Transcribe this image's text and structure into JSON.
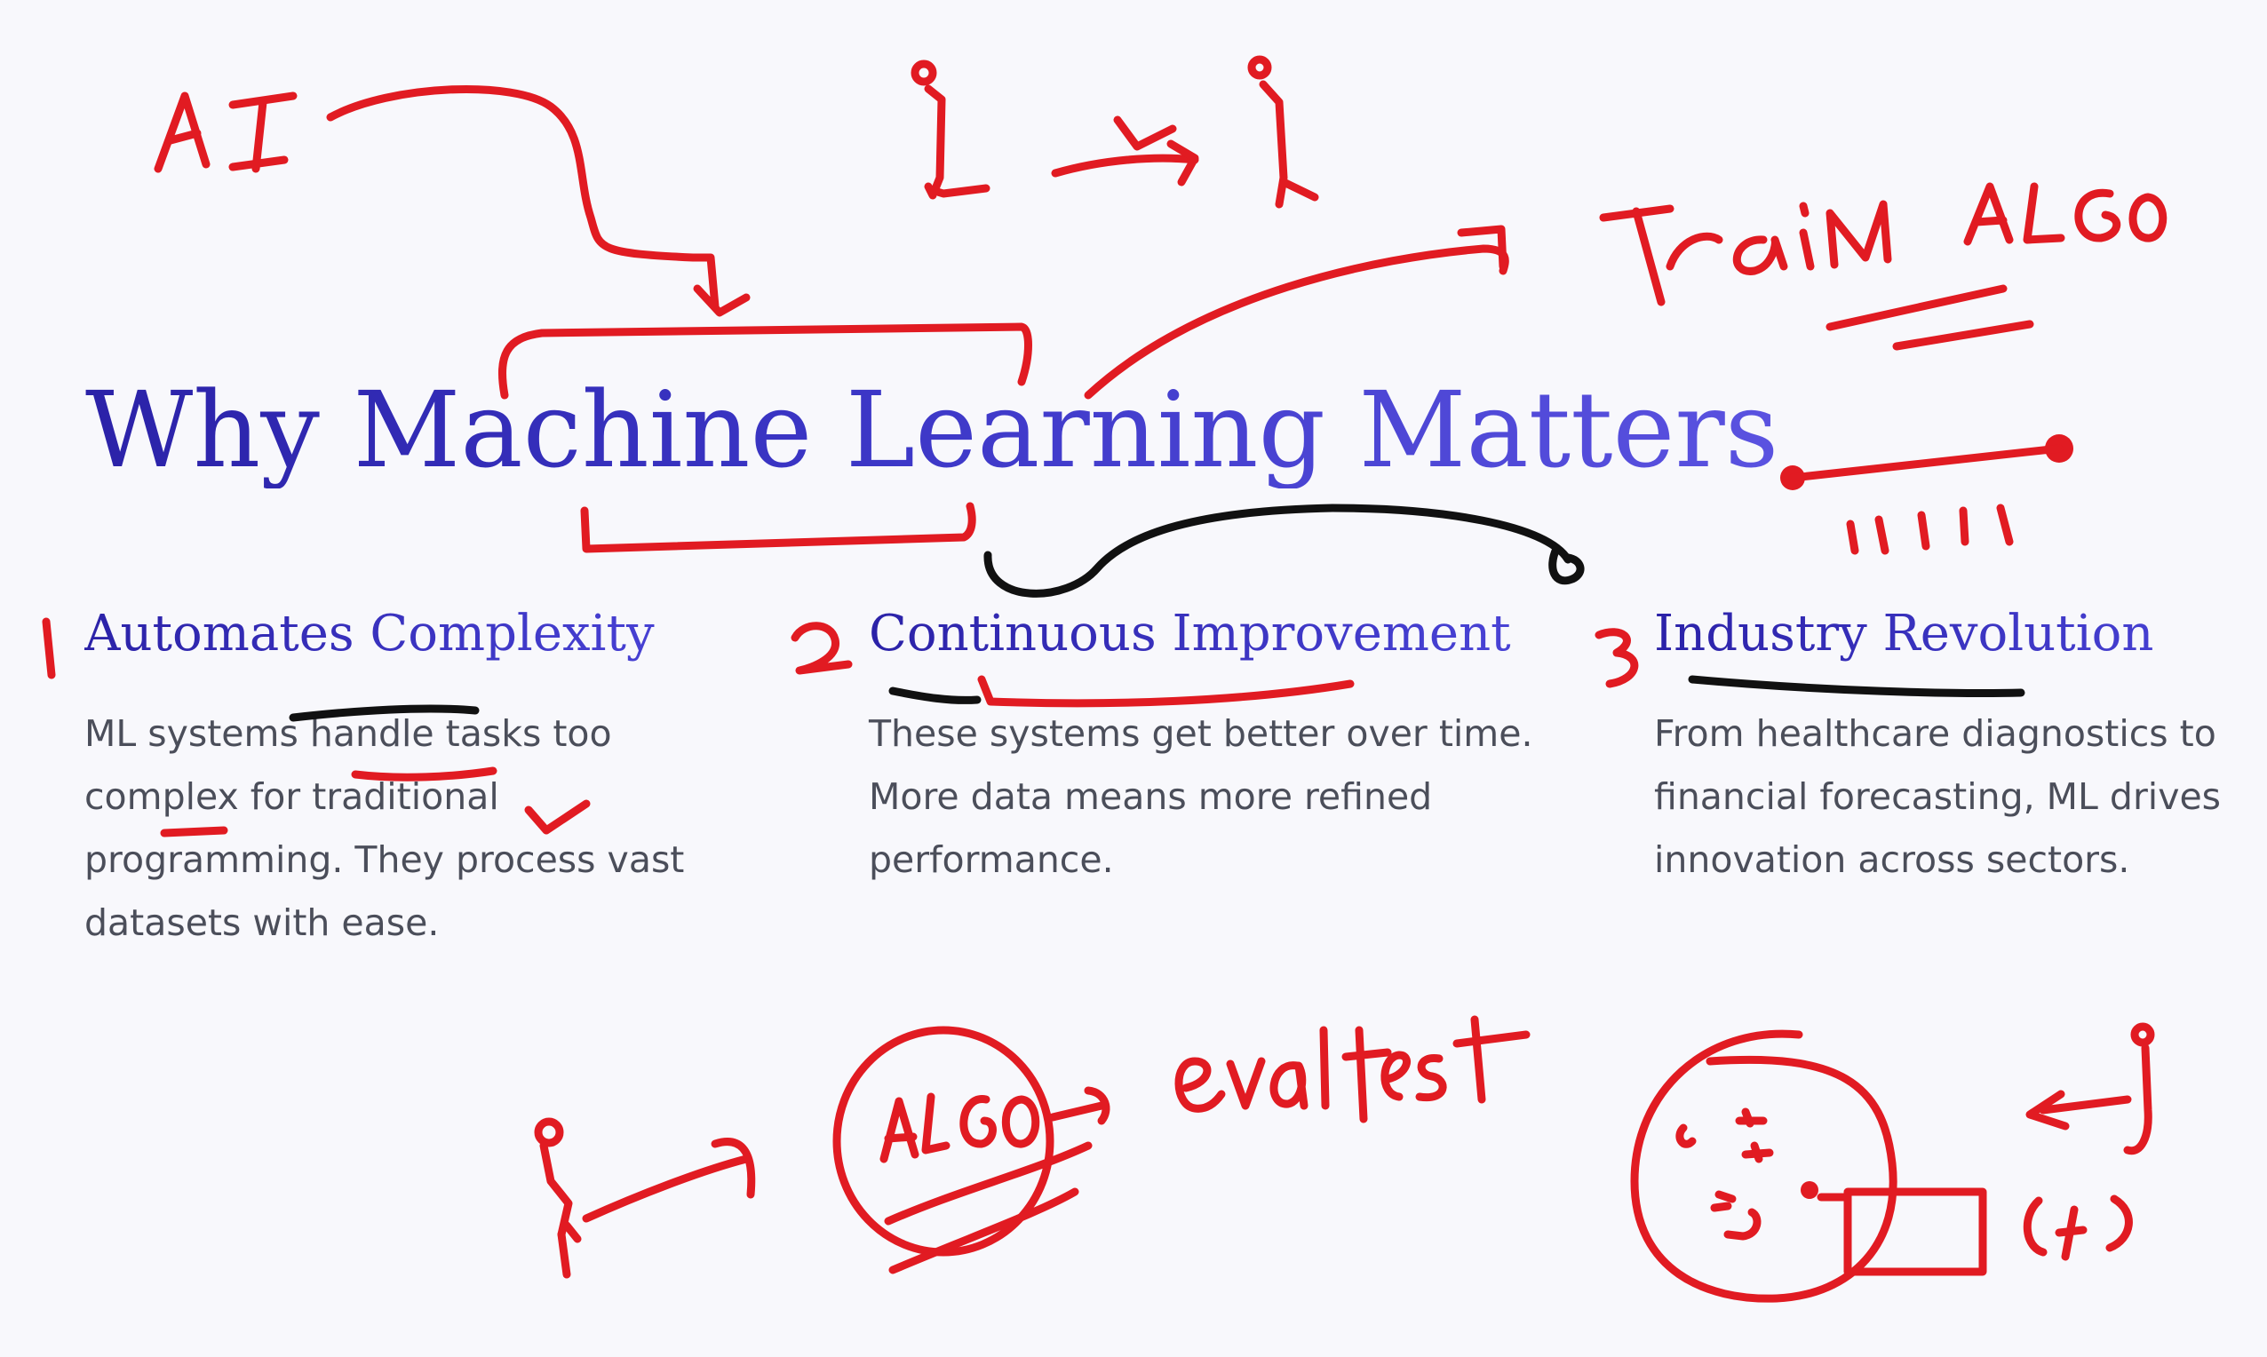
{
  "slide": {
    "title": "Why Machine Learning Matters",
    "columns": [
      {
        "heading": "Automates Complexity",
        "body": "ML systems handle tasks too complex for traditional programming. They process vast datasets with ease."
      },
      {
        "heading": "Continuous Improvement",
        "body": "These systems get better over time. More data means more refined performance."
      },
      {
        "heading": "Industry Revolution",
        "body": "From healthcare diagnostics to financial forecasting, ML drives innovation across sectors."
      }
    ]
  },
  "annotations": {
    "ai": "AI",
    "train_algo": "Train ALGO",
    "algo": "ALGO",
    "eval_test": "eval test",
    "marks": "11111",
    "number_1": "1",
    "number_2": "2",
    "number_3": "3",
    "ink_color": "#e11b22",
    "ink_color_secondary": "#111111"
  }
}
